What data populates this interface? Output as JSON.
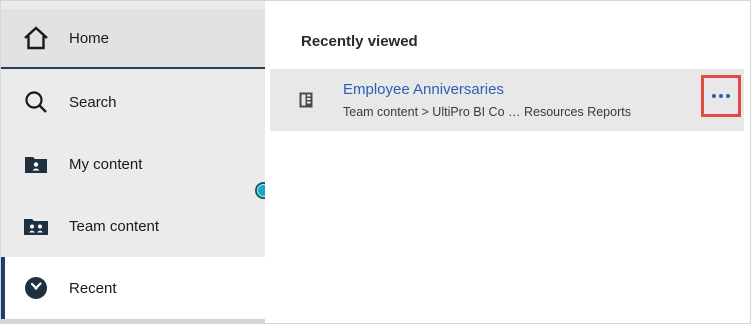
{
  "sidebar": {
    "items": [
      {
        "label": "Home",
        "icon": "home-icon"
      },
      {
        "label": "Search",
        "icon": "search-icon"
      },
      {
        "label": "My content",
        "icon": "my-content-icon"
      },
      {
        "label": "Team content",
        "icon": "team-content-icon"
      },
      {
        "label": "Recent",
        "icon": "recent-icon"
      }
    ],
    "selected": "Recent"
  },
  "main": {
    "section_title": "Recently viewed",
    "recent_items": [
      {
        "title": "Employee Anniversaries",
        "path": "Team content > UltiPro BI Co … Resources Reports",
        "icon": "report-icon",
        "actions_icon": "more-options-icon"
      }
    ]
  },
  "colors": {
    "sidebar_bg": "#ebebeb",
    "link": "#2b5fb4",
    "highlight_border": "#e04a3f",
    "handle": "#1ba7c4",
    "selected_bar": "#1f3d6e"
  }
}
